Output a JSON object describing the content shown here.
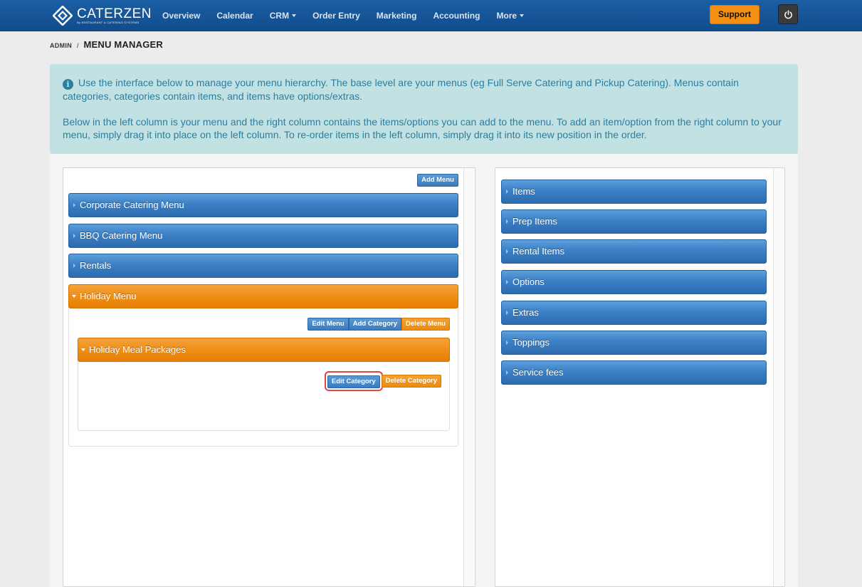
{
  "header": {
    "brand": "CATERZEN",
    "brand_sub": "By RESTAURANT & CATERING SYSTEMS",
    "nav": [
      {
        "label": "Overview",
        "dropdown": false
      },
      {
        "label": "Calendar",
        "dropdown": false
      },
      {
        "label": "CRM",
        "dropdown": true
      },
      {
        "label": "Order Entry",
        "dropdown": false
      },
      {
        "label": "Marketing",
        "dropdown": false
      },
      {
        "label": "Accounting",
        "dropdown": false
      },
      {
        "label": "More",
        "dropdown": true
      }
    ],
    "support_label": "Support",
    "power_icon": "power-icon"
  },
  "breadcrumb": {
    "section": "ADMIN",
    "separator": "/",
    "page": "MENU MANAGER"
  },
  "alert": {
    "icon": "info-icon",
    "paragraph1": "Use the interface below to manage your menu hierarchy. The base level are your menus (eg Full Serve Catering and Pickup Catering). Menus contain categories, categories contain items, and items have options/extras.",
    "paragraph2": "Below in the left column is your menu and the right column contains the items/options you can add to the menu. To add an item/option from the right column to your menu, simply drag it into place on the left column. To re-order items in the left column, simply drag it into its new position in the order."
  },
  "left_panel": {
    "add_menu_label": "Add Menu",
    "menus": [
      {
        "label": "Corporate Catering Menu"
      },
      {
        "label": "BBQ Catering Menu"
      },
      {
        "label": "Rentals"
      }
    ],
    "expanded_menu": {
      "label": "Holiday Menu",
      "actions": {
        "edit": "Edit Menu",
        "add_category": "Add Category",
        "delete": "Delete Menu"
      },
      "category": {
        "label": "Holiday Meal Packages",
        "actions": {
          "edit": "Edit Category",
          "delete": "Delete Category"
        }
      }
    }
  },
  "right_panel": {
    "groups": [
      {
        "label": "Items"
      },
      {
        "label": "Prep Items"
      },
      {
        "label": "Rental Items"
      },
      {
        "label": "Options"
      },
      {
        "label": "Extras"
      },
      {
        "label": "Toppings"
      },
      {
        "label": "Service fees"
      }
    ]
  },
  "colors": {
    "nav_bg": "#1b5fa5",
    "accent_orange": "#f39014",
    "bar_blue": "#3b80c6",
    "alert_bg": "#c1e1e3",
    "alert_text": "#2b7ea0",
    "highlight_ring": "#e0463f"
  }
}
